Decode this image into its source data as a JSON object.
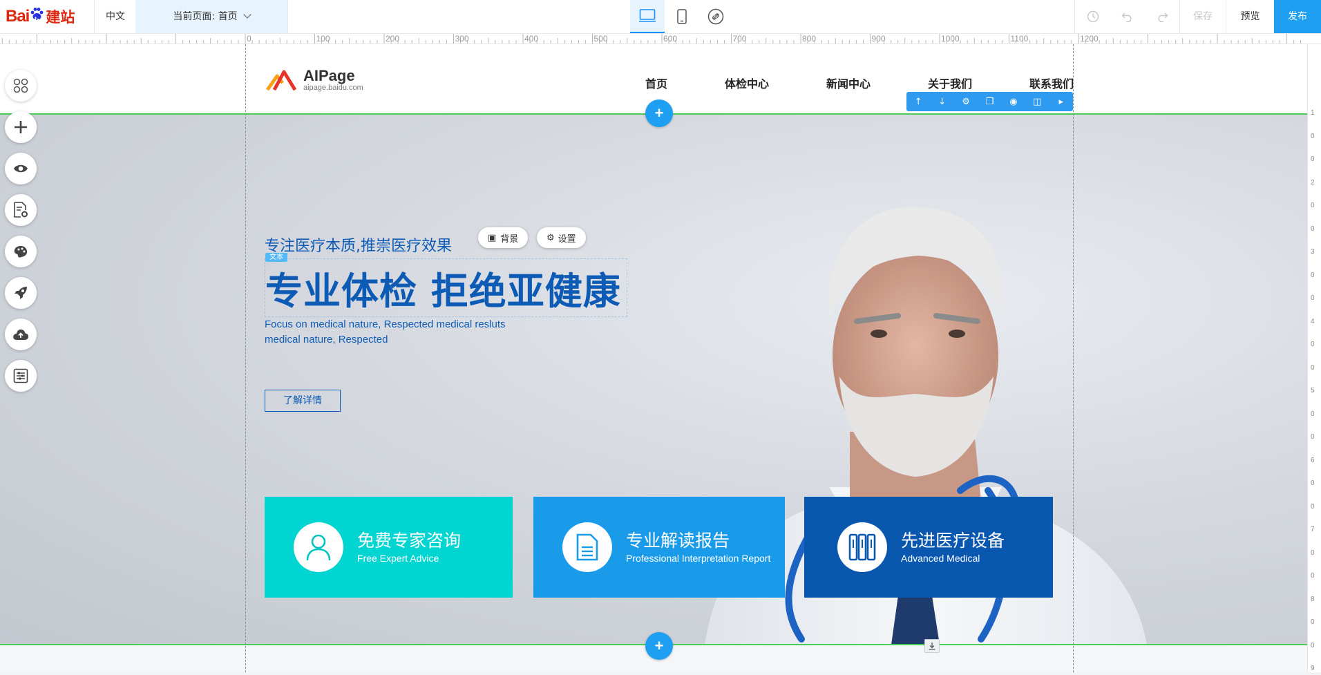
{
  "topbar": {
    "logo": {
      "bai": "Bai",
      "du": "du",
      "jianzhan": "建站"
    },
    "language": "中文",
    "current_page": "当前页面: 首页",
    "devices": [
      {
        "name": "desktop-icon",
        "active": true
      },
      {
        "name": "mobile-icon",
        "active": false
      },
      {
        "name": "link-icon",
        "active": false
      }
    ],
    "history_icon": "history-icon",
    "undo_icon": "undo-icon",
    "redo_icon": "redo-icon",
    "save_label": "保存",
    "preview_label": "预览",
    "publish_label": "发布"
  },
  "ruler": {
    "horizontal": [
      "0",
      "100",
      "200",
      "300",
      "400",
      "500",
      "600",
      "700",
      "800",
      "900",
      "1000",
      "1100",
      "1200"
    ],
    "vertical": [
      "1",
      "0",
      "0",
      "2",
      "0",
      "0",
      "3",
      "0",
      "0",
      "4",
      "0",
      "0",
      "5",
      "0",
      "0",
      "6",
      "0",
      "0",
      "7",
      "0",
      "0",
      "8",
      "0",
      "0",
      "9"
    ]
  },
  "sidebar": {
    "items": [
      {
        "name": "modules-icon"
      },
      {
        "name": "add-icon"
      },
      {
        "name": "eye-icon"
      },
      {
        "name": "page-settings-icon"
      },
      {
        "name": "palette-icon"
      },
      {
        "name": "rocket-icon"
      },
      {
        "name": "cloud-upload-icon"
      },
      {
        "name": "sliders-icon"
      }
    ]
  },
  "site": {
    "logo_name": "AIPage",
    "logo_sub": "aipage.baidu.com",
    "nav": [
      "首页",
      "体检中心",
      "新闻中心",
      "关于我们",
      "联系我们"
    ]
  },
  "element_toolbar": {
    "icons": [
      "move-up-icon",
      "move-down-icon",
      "gear-icon",
      "copy-icon",
      "globe-icon",
      "trash-icon",
      "play-icon"
    ]
  },
  "hero": {
    "subtitle": "专注医疗本质,推崇医疗效果",
    "background_button": "背景",
    "settings_button": "设置",
    "text_tag": "文本",
    "headline": "专业体检  拒绝亚健康",
    "description_line1": "Focus on medical nature, Respected medical resluts",
    "description_line2": "medical nature, Respected",
    "detail_button": "了解详情",
    "cards": [
      {
        "title": "免费专家咨询",
        "subtitle": "Free Expert Advice",
        "icon": "user-icon",
        "color": "#00d5d2"
      },
      {
        "title": "专业解读报告",
        "subtitle": "Professional Interpretation Report",
        "icon": "document-icon",
        "color": "#1a9bea"
      },
      {
        "title": "先进医疗设备",
        "subtitle": "Advanced Medical",
        "icon": "equipment-icon",
        "color": "#0a57b0"
      }
    ]
  },
  "colors": {
    "accent": "#1e9ff2",
    "brand_blue": "#0d5bb5",
    "selection_green": "#4cca5a"
  }
}
